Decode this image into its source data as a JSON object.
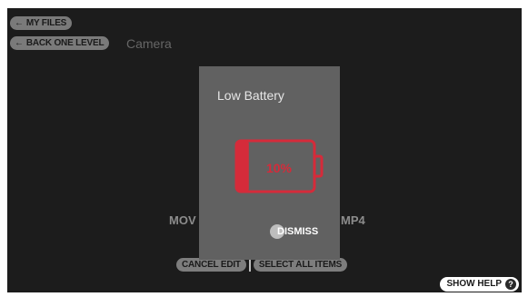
{
  "nav": {
    "my_files_arrow": "←",
    "my_files_label": "MY FILES",
    "back_arrow": "←",
    "back_label": "BACK ONE LEVEL",
    "current_folder": "Camera"
  },
  "files": {
    "left_label": "MOV",
    "right_label": "MP4"
  },
  "bottom_bar": {
    "cancel_label": "CANCEL EDIT",
    "select_all_label": "SELECT ALL ITEMS"
  },
  "help": {
    "label": "SHOW HELP",
    "icon_glyph": "?"
  },
  "dialog": {
    "title": "Low Battery",
    "battery_percent_text": "10%",
    "battery_level_percent": 10,
    "dismiss_label": "DISMISS"
  },
  "colors": {
    "background": "#1c1c1c",
    "dialog_background": "#616161",
    "battery_red": "#d52b3a"
  },
  "icons": {
    "nav_arrow": "left-arrow-icon",
    "battery": "battery-low-icon",
    "help": "question-mark-icon"
  }
}
